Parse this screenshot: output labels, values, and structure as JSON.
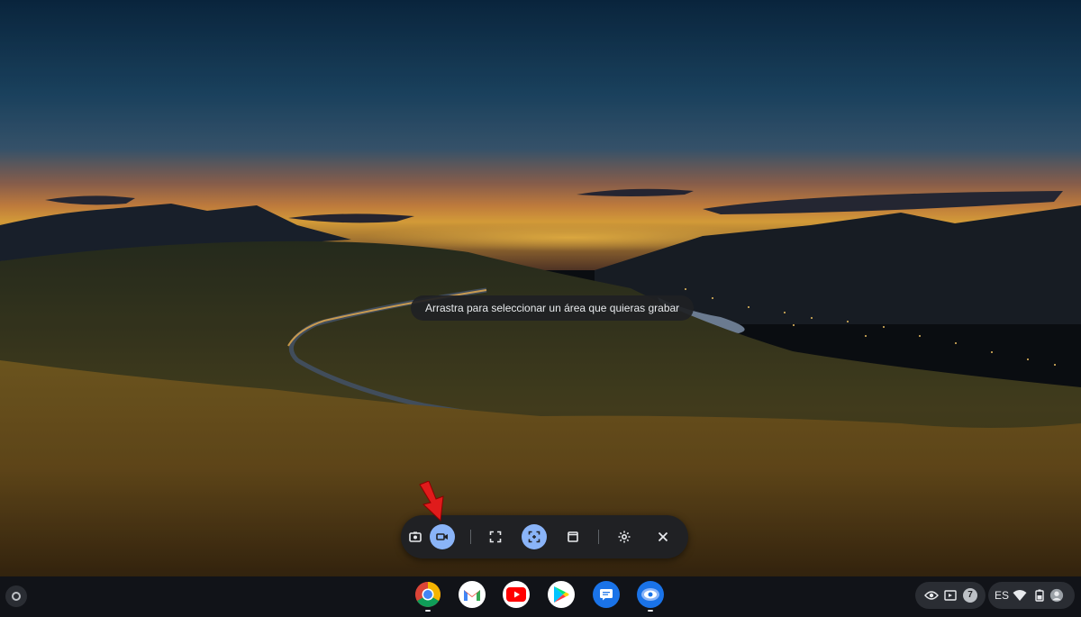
{
  "screen": {
    "hint_text": "Arrastra para seleccionar un área que quieras grabar"
  },
  "capture_bar": {
    "modes": [
      {
        "name": "screenshot",
        "icon": "camera-icon",
        "active": false
      },
      {
        "name": "screen-record",
        "icon": "videocam-icon",
        "active": true
      }
    ],
    "sources": [
      {
        "name": "fullscreen",
        "icon": "fullscreen-icon",
        "active": false
      },
      {
        "name": "partial",
        "icon": "partial-region-icon",
        "active": true
      },
      {
        "name": "window",
        "icon": "window-icon",
        "active": false
      }
    ],
    "settings_icon": "gear-icon",
    "close_icon": "close-icon"
  },
  "annotation": {
    "arrow_color": "#e01b1b"
  },
  "shelf": {
    "launcher_icon": "launcher-icon",
    "apps": [
      {
        "name": "Chrome",
        "icon": "chrome-icon",
        "running": true
      },
      {
        "name": "Gmail",
        "icon": "gmail-icon",
        "running": false
      },
      {
        "name": "YouTube",
        "icon": "youtube-icon",
        "running": false
      },
      {
        "name": "Play Store",
        "icon": "play-store-icon",
        "running": false
      },
      {
        "name": "Files",
        "icon": "files-icon",
        "running": false
      },
      {
        "name": "Screen Capture",
        "icon": "screen-capture-icon",
        "running": true
      }
    ],
    "tray": {
      "notification_count": "7",
      "language": "ES"
    }
  },
  "colors": {
    "accent": "#8ab4f8",
    "bar_bg": "#202124",
    "shelf_bg": "#111318"
  }
}
